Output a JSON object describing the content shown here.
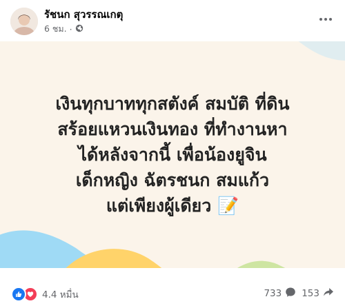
{
  "post": {
    "author": "รัชนก สุวรรณเกตุ",
    "time": "6 ชม.",
    "separator": "·",
    "text_lines": [
      "เงินทุกบาททุกสตังค์ สมบัติ ที่ดิน",
      "สร้อยแหวนเงินทอง ที่ทำงานหา",
      "ได้หลังจากนี้ เพื่อน้องยูจิน",
      "เด็กหญิง ฉัตรชนก สมแก้ว",
      "แต่เพียงผู้เดียว"
    ],
    "text_emoji": "📝"
  },
  "engagement": {
    "reactions_count": "4.4 หมื่น",
    "comments_count": "733",
    "shares_count": "153"
  },
  "icons": {
    "privacy": "globe-icon",
    "more": "more-horizontal-icon",
    "like": "like-icon",
    "love": "love-icon",
    "comment": "comment-icon",
    "share": "share-icon"
  },
  "colors": {
    "card_bg": "#fbf4ea",
    "accent_blue": "#9fdaf5",
    "accent_yellow": "#ffd36a",
    "accent_green": "#c9e39a",
    "like_blue": "#1877f2",
    "love_red": "#f33e58"
  }
}
